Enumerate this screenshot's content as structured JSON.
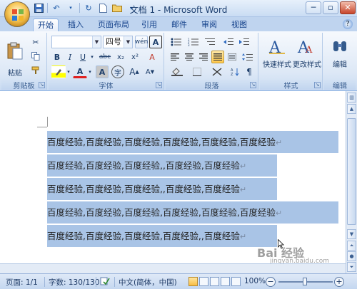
{
  "window": {
    "title": "文档 1 - Microsoft Word",
    "controls": {
      "minimize": "─",
      "restore": "▫",
      "close": "✕"
    }
  },
  "tabs": [
    {
      "label": "开始",
      "active": true
    },
    {
      "label": "插入"
    },
    {
      "label": "页面布局"
    },
    {
      "label": "引用"
    },
    {
      "label": "邮件"
    },
    {
      "label": "审阅"
    },
    {
      "label": "视图"
    }
  ],
  "ribbon": {
    "clipboard": {
      "label": "剪贴板",
      "paste": "粘贴"
    },
    "font": {
      "label": "字体",
      "font_name": "",
      "font_size": "四号",
      "bold": "B",
      "italic": "I",
      "underline": "U",
      "strike": "abc",
      "subscript": "x₂",
      "superscript": "x²",
      "clear": "A",
      "font_color": "A",
      "char_shading": "A",
      "enclose": "字",
      "grow": "A",
      "shrink": "A",
      "phonetic": "wén",
      "border": "A"
    },
    "paragraph": {
      "label": "段落"
    },
    "styles": {
      "label": "样式",
      "quick_styles": "快速样式",
      "change_styles": "更改样式"
    },
    "editing": {
      "label": "编辑"
    }
  },
  "document": {
    "lines": [
      "百度经验,百度经验,百度经验,百度经验,百度经验,百度经验",
      "百度经验,百度经验,百度经验,,百度经验,百度经验",
      "百度经验,百度经验,百度经验,,百度经验,百度经验",
      "百度经验,百度经验,百度经验,百度经验,百度经验,百度经验",
      "百度经验,百度经验,百度经验,百度经验,,百度经验"
    ],
    "paragraph_mark": "↵",
    "watermark": "Bai 经验",
    "watermark_url": "jingyan.baidu.com"
  },
  "statusbar": {
    "page": "页面: 1/1",
    "words": "字数: 130/130",
    "language": "中文(简体，中国)",
    "zoom": "100%",
    "zoom_minus": "−",
    "zoom_plus": "+"
  }
}
